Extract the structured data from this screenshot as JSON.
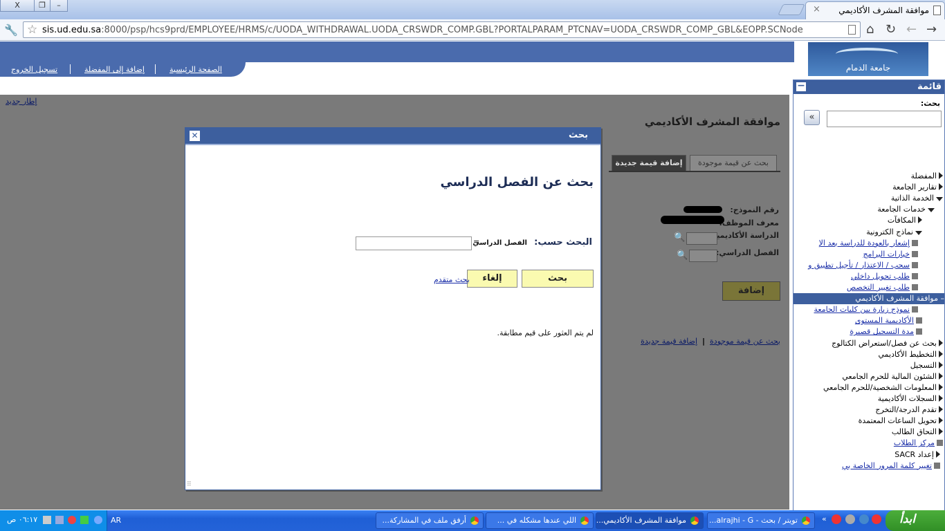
{
  "browser": {
    "tab_title": "موافقة المشرف الأكاديمي",
    "url_host": "sis.ud.edu.sa",
    "url_rest": ":8000/psp/hcs9prd/EMPLOYEE/HRMS/c/UODA_WITHDRAWAL.UODA_CRSWDR_COMP.GBL?PORTALPARAM_PTCNAV=UODA_CRSWDR_COMP_GBL&EOPP.SCNode"
  },
  "header": {
    "logo_text": "جامعة الدمام",
    "links": [
      "الصفحة الرئيسية",
      "إضافة إلى المفضلة",
      "تسجيل الخروج"
    ],
    "new_window": "إطار جديد"
  },
  "page": {
    "heading": "موافقة المشرف الأكاديمي",
    "tabs": [
      "بحث عن قيمة موجودة",
      "إضافة قيمة جديدة"
    ],
    "labels": {
      "form_number": "رقم النموذج:",
      "employee_id": "معرف الموظف:",
      "academic_career": "الدراسة الأكاديمية:",
      "term": "الفصل الدراسي:"
    },
    "add_button": "إضافة",
    "bottom_links": [
      "بحث عن قيمة موجودة",
      "إضافة قيمة جديدة"
    ]
  },
  "menu": {
    "title": "قائمة",
    "search_label": "بحث:",
    "items": [
      {
        "label": "المفضلة",
        "icon": "arrow",
        "indent": 0
      },
      {
        "label": "تقارير الجامعة",
        "icon": "arrow",
        "indent": 0
      },
      {
        "label": "الخدمة الذاتية",
        "icon": "down",
        "indent": 0
      },
      {
        "label": "خدمات الجامعة",
        "icon": "down",
        "indent": 1
      },
      {
        "label": "المكافآت",
        "icon": "arrow",
        "indent": 2
      },
      {
        "label": "نماذج الكترونية",
        "icon": "down",
        "indent": 2
      },
      {
        "label": "إشعار بالعودة للدراسة بعد الإ",
        "icon": "box",
        "indent": 3,
        "link": true
      },
      {
        "label": "خيارات البرامج",
        "icon": "box",
        "indent": 3,
        "link": true
      },
      {
        "label": "سحب / الاعتذار / تأجيل تطبيق و",
        "icon": "box",
        "indent": 3,
        "link": true
      },
      {
        "label": "طلب تحويل داخلي",
        "icon": "box",
        "indent": 3,
        "link": true
      },
      {
        "label": "طلب تغيير التخصص",
        "icon": "box",
        "indent": 3,
        "link": true
      },
      {
        "label": "– موافقة المشرف الأكاديمي",
        "icon": "none",
        "indent": 3,
        "selected": true
      },
      {
        "label": "نموذج زيارة بين كليات الجامعة",
        "icon": "box",
        "indent": 3,
        "link": true
      },
      {
        "label": "الأكاديمية المستوى",
        "icon": "box",
        "indent": 2,
        "link": true
      },
      {
        "label": "مدة التسجيل قصيرة",
        "icon": "box",
        "indent": 2,
        "link": true
      },
      {
        "label": "بحث عن فصل/استعراض الكتالوج",
        "icon": "arrow",
        "indent": 0
      },
      {
        "label": "التخطيط الأكاديمي",
        "icon": "arrow",
        "indent": 0
      },
      {
        "label": "التسجيل",
        "icon": "arrow",
        "indent": 0
      },
      {
        "label": "الشئون المالية للحرم الجامعي",
        "icon": "arrow",
        "indent": 0
      },
      {
        "label": "المعلومات الشخصية/للحرم الجامعي",
        "icon": "arrow",
        "indent": 0
      },
      {
        "label": "السجلات الأكاديمية",
        "icon": "arrow",
        "indent": 0
      },
      {
        "label": "تقدم الدرجة/التخرج",
        "icon": "arrow",
        "indent": 0
      },
      {
        "label": "تحويل الساعات المعتمدة",
        "icon": "arrow",
        "indent": 0
      },
      {
        "label": "التحاق الطالب",
        "icon": "arrow",
        "indent": 0
      },
      {
        "label": "مركز الطلاب",
        "icon": "box",
        "indent": 0,
        "link": true
      },
      {
        "label": "إعداد SACR",
        "icon": "arrow",
        "indent": -1
      },
      {
        "label": "تغيير كلمة المرور الخاصة بي",
        "icon": "box",
        "indent": -1,
        "link": true
      }
    ]
  },
  "modal": {
    "title": "بحث",
    "heading": "بحث عن الفصل الدراسي",
    "search_by": "البحث حسب:",
    "field_label": "الفصل الدراسي",
    "operator": "=",
    "field_value": "",
    "search_button": "بحث",
    "cancel_button": "إلغاء",
    "advanced_search": "بحث متقدم",
    "no_match": "لم يتم العثور على قيم مطابقة."
  },
  "taskbar": {
    "start": "ابدأ",
    "buttons": [
      {
        "label": "تويتر / بحث - alrajhi - G...",
        "active": false
      },
      {
        "label": "موافقة المشرف الأكاديمي...",
        "active": true
      },
      {
        "label": "اللي عندها مشكله في ...",
        "active": false
      },
      {
        "label": "أرفق ملف في المشاركة...",
        "active": false
      }
    ],
    "lang": "AR",
    "clock": "٠٦:١٧ ص"
  }
}
